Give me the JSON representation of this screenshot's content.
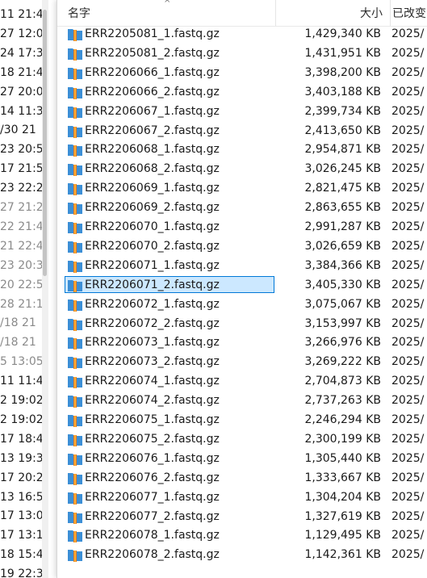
{
  "left_pane": {
    "rows": [
      {
        "text": "11  21:4",
        "dim": false
      },
      {
        "text": "27  12:0",
        "dim": false
      },
      {
        "text": "24  17:3",
        "dim": false
      },
      {
        "text": "18  21:4",
        "dim": false
      },
      {
        "text": "27  20:0",
        "dim": false
      },
      {
        "text": "14  11:3",
        "dim": false
      },
      {
        "text": "/30  21",
        "dim": false
      },
      {
        "text": "23  20:5",
        "dim": false
      },
      {
        "text": "17  21:5",
        "dim": false
      },
      {
        "text": "23  22:2",
        "dim": false
      },
      {
        "text": "27  21:2",
        "dim": true
      },
      {
        "text": "22  21:4",
        "dim": true
      },
      {
        "text": "21  22:4",
        "dim": true
      },
      {
        "text": "23  20:3",
        "dim": true
      },
      {
        "text": "20  22:5",
        "dim": true
      },
      {
        "text": "28  21:1",
        "dim": true
      },
      {
        "text": "/18  21",
        "dim": true
      },
      {
        "text": "/18  21",
        "dim": true
      },
      {
        "text": "5  13:05",
        "dim": true
      },
      {
        "text": "11  11:4",
        "dim": false
      },
      {
        "text": "2  19:02",
        "dim": false
      },
      {
        "text": "2  19:02",
        "dim": false
      },
      {
        "text": "17  18:4",
        "dim": false
      },
      {
        "text": "13  19:3",
        "dim": false
      },
      {
        "text": "17  20:2",
        "dim": false
      },
      {
        "text": "13  16:5",
        "dim": false
      },
      {
        "text": "17  13:0",
        "dim": false
      },
      {
        "text": "17  13:1",
        "dim": false
      },
      {
        "text": "18  15:4",
        "dim": false
      },
      {
        "text": "19  22:3",
        "dim": false
      }
    ]
  },
  "header": {
    "name_label": "名字",
    "size_label": "大小",
    "date_label": "已改变",
    "sort_indicator": "^"
  },
  "colors": {
    "selection_bg": "#cce8ff",
    "selection_border": "#0078d7",
    "icon_blue": "#3c8fd6",
    "icon_orange": "#e8781c"
  },
  "files": [
    {
      "name": "ERR2205081_1.fastq.gz",
      "size": "1,429,340 KB",
      "date": "2025/",
      "selected": false
    },
    {
      "name": "ERR2205081_2.fastq.gz",
      "size": "1,431,951 KB",
      "date": "2025/",
      "selected": false
    },
    {
      "name": "ERR2206066_1.fastq.gz",
      "size": "3,398,200 KB",
      "date": "2025/",
      "selected": false
    },
    {
      "name": "ERR2206066_2.fastq.gz",
      "size": "3,403,188 KB",
      "date": "2025/",
      "selected": false
    },
    {
      "name": "ERR2206067_1.fastq.gz",
      "size": "2,399,734 KB",
      "date": "2025/",
      "selected": false
    },
    {
      "name": "ERR2206067_2.fastq.gz",
      "size": "2,413,650 KB",
      "date": "2025/",
      "selected": false
    },
    {
      "name": "ERR2206068_1.fastq.gz",
      "size": "2,954,871 KB",
      "date": "2025/",
      "selected": false
    },
    {
      "name": "ERR2206068_2.fastq.gz",
      "size": "3,026,245 KB",
      "date": "2025/",
      "selected": false
    },
    {
      "name": "ERR2206069_1.fastq.gz",
      "size": "2,821,475 KB",
      "date": "2025/",
      "selected": false
    },
    {
      "name": "ERR2206069_2.fastq.gz",
      "size": "2,863,655 KB",
      "date": "2025/",
      "selected": false
    },
    {
      "name": "ERR2206070_1.fastq.gz",
      "size": "2,991,287 KB",
      "date": "2025/",
      "selected": false
    },
    {
      "name": "ERR2206070_2.fastq.gz",
      "size": "3,026,659 KB",
      "date": "2025/",
      "selected": false
    },
    {
      "name": "ERR2206071_1.fastq.gz",
      "size": "3,384,366 KB",
      "date": "2025/",
      "selected": false
    },
    {
      "name": "ERR2206071_2.fastq.gz",
      "size": "3,405,330 KB",
      "date": "2025/",
      "selected": true
    },
    {
      "name": "ERR2206072_1.fastq.gz",
      "size": "3,075,067 KB",
      "date": "2025/",
      "selected": false
    },
    {
      "name": "ERR2206072_2.fastq.gz",
      "size": "3,153,997 KB",
      "date": "2025/",
      "selected": false
    },
    {
      "name": "ERR2206073_1.fastq.gz",
      "size": "3,266,976 KB",
      "date": "2025/",
      "selected": false
    },
    {
      "name": "ERR2206073_2.fastq.gz",
      "size": "3,269,222 KB",
      "date": "2025/",
      "selected": false
    },
    {
      "name": "ERR2206074_1.fastq.gz",
      "size": "2,704,873 KB",
      "date": "2025/",
      "selected": false
    },
    {
      "name": "ERR2206074_2.fastq.gz",
      "size": "2,737,263 KB",
      "date": "2025/",
      "selected": false
    },
    {
      "name": "ERR2206075_1.fastq.gz",
      "size": "2,246,294 KB",
      "date": "2025/",
      "selected": false
    },
    {
      "name": "ERR2206075_2.fastq.gz",
      "size": "2,300,199 KB",
      "date": "2025/",
      "selected": false
    },
    {
      "name": "ERR2206076_1.fastq.gz",
      "size": "1,305,440 KB",
      "date": "2025/",
      "selected": false
    },
    {
      "name": "ERR2206076_2.fastq.gz",
      "size": "1,333,667 KB",
      "date": "2025/",
      "selected": false
    },
    {
      "name": "ERR2206077_1.fastq.gz",
      "size": "1,304,204 KB",
      "date": "2025/",
      "selected": false
    },
    {
      "name": "ERR2206077_2.fastq.gz",
      "size": "1,327,619 KB",
      "date": "2025/",
      "selected": false
    },
    {
      "name": "ERR2206078_1.fastq.gz",
      "size": "1,129,495 KB",
      "date": "2025/",
      "selected": false
    },
    {
      "name": "ERR2206078_2.fastq.gz",
      "size": "1,142,361 KB",
      "date": "2025/",
      "selected": false
    }
  ]
}
